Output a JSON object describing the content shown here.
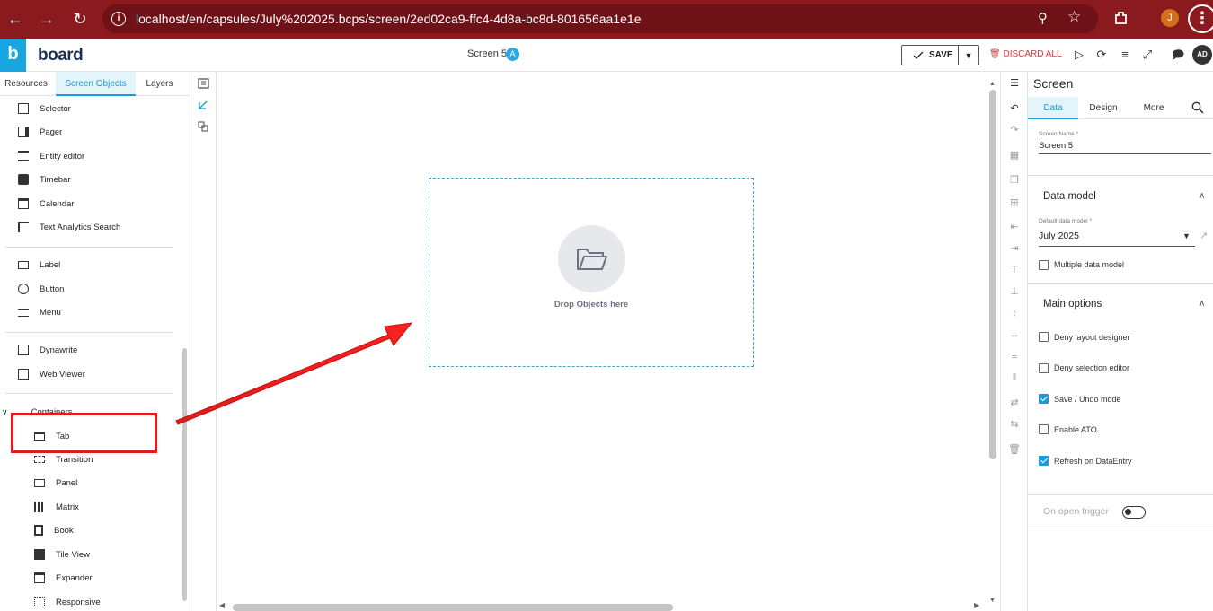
{
  "browser": {
    "url": "localhost/en/capsules/July%202025.bcps/screen/2ed02ca9-ffc4-4d8a-bc8d-801656aa1e1e",
    "profile_initial": "J"
  },
  "header": {
    "logo_letter": "b",
    "logo_text": "board",
    "screen_title": "Screen 5",
    "screen_badge": "A",
    "save_label": "SAVE",
    "discard_label": "DISCARD ALL",
    "avatar": "AD"
  },
  "left_panel": {
    "tabs": [
      "Resources",
      "Screen Objects",
      "Layers"
    ],
    "active_tab": "Screen Objects",
    "group1": [
      "Selector",
      "Pager",
      "Entity editor",
      "Timebar",
      "Calendar",
      "Text Analytics Search"
    ],
    "group2": [
      "Label",
      "Button",
      "Menu"
    ],
    "group3": [
      "Dynawrite",
      "Web Viewer"
    ],
    "containers_label": "Containers",
    "containers": [
      "Tab",
      "Transition",
      "Panel",
      "Matrix",
      "Book",
      "Tile View",
      "Expander",
      "Responsive"
    ]
  },
  "canvas": {
    "drop_label": "Drop Objects here"
  },
  "right_panel": {
    "title": "Screen",
    "tabs": [
      "Data",
      "Design",
      "More"
    ],
    "active_tab": "Data",
    "screen_name_label": "Screen Name *",
    "screen_name_value": "Screen 5",
    "data_model_section": "Data model",
    "default_model_label": "Default data model *",
    "default_model_value": "July 2025",
    "multiple_model_label": "Multiple data model",
    "main_options_section": "Main options",
    "options": [
      {
        "label": "Deny layout designer",
        "checked": false
      },
      {
        "label": "Deny selection editor",
        "checked": false
      },
      {
        "label": "Save / Undo mode",
        "checked": true
      },
      {
        "label": "Enable ATO",
        "checked": false
      },
      {
        "label": "Refresh on DataEntry",
        "checked": true
      }
    ],
    "trigger_label": "On open trigger"
  }
}
